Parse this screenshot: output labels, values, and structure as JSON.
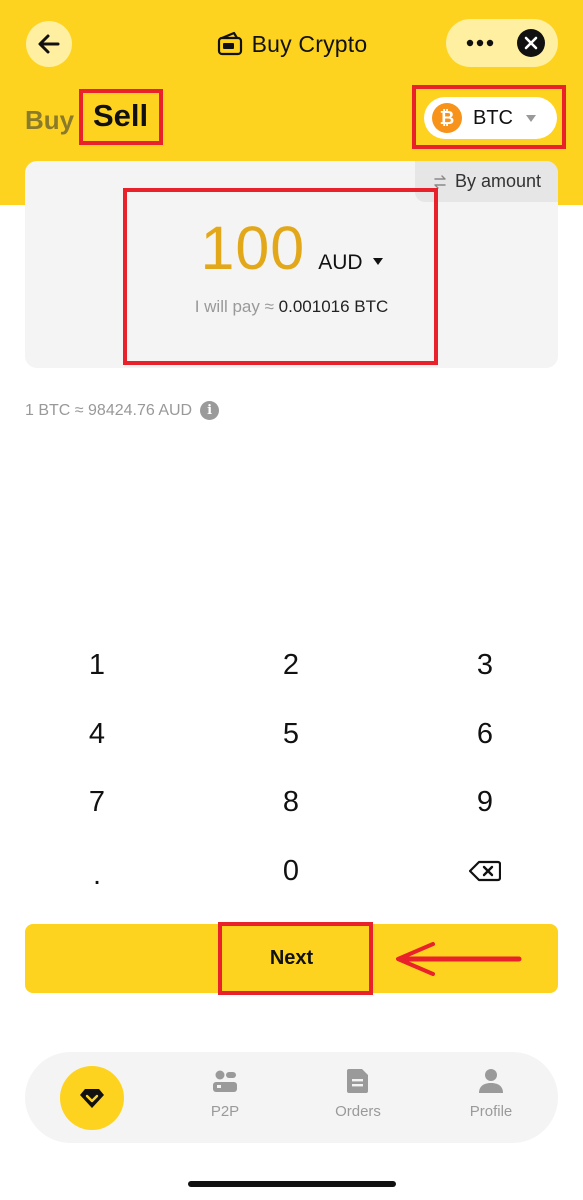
{
  "header": {
    "title": "Buy Crypto",
    "back_icon": "arrow-left-icon",
    "title_icon": "wallet-card-icon",
    "more_icon": "more-dots-icon",
    "close_icon": "close-icon"
  },
  "tabs": {
    "buy_label": "Buy",
    "sell_label": "Sell",
    "active": "Sell"
  },
  "coin_selector": {
    "symbol": "BTC",
    "icon": "bitcoin-icon",
    "badge_glyph": "₿"
  },
  "amount_card": {
    "mode_label": "By amount",
    "mode_icon": "swap-icon",
    "amount": "100",
    "currency": "AUD",
    "pay_label": "I will pay ≈",
    "pay_value": "0.001016 BTC"
  },
  "rate": {
    "text": "1 BTC ≈ 98424.76 AUD",
    "info_glyph": "i"
  },
  "keypad": {
    "k1": "1",
    "k2": "2",
    "k3": "3",
    "k4": "4",
    "k5": "5",
    "k6": "6",
    "k7": "7",
    "k8": "8",
    "k9": "9",
    "kdot": ".",
    "k0": "0",
    "backspace_icon": "backspace-icon"
  },
  "next_button": {
    "label": "Next"
  },
  "bottom_nav": {
    "home_icon": "diamond-logo-icon",
    "p2p_label": "P2P",
    "orders_label": "Orders",
    "profile_label": "Profile"
  },
  "colors": {
    "brand_yellow": "#FED31F",
    "amount_gold": "#E3A81A",
    "annotation_red": "#E8212A",
    "bitcoin_orange": "#F7931A"
  }
}
